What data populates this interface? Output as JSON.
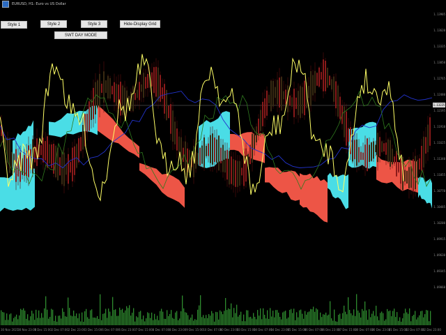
{
  "window": {
    "title": "EURUSD, H1: Euro vs US Dollar",
    "icon": "chart-window-icon"
  },
  "buttons": [
    {
      "id": "style1",
      "label": "Style 1"
    },
    {
      "id": "style2",
      "label": "Style 2"
    },
    {
      "id": "style3",
      "label": "Style 3"
    },
    {
      "id": "grid",
      "label": "Hide-Display Grid"
    },
    {
      "id": "daymode",
      "label": "SWT DAY MODE"
    }
  ],
  "price_axis": {
    "ticks": [
      "1.13905",
      "1.13620",
      "1.13335",
      "1.13050",
      "1.12765",
      "1.12480",
      "1.12195",
      "1.11910",
      "1.11625",
      "1.11340",
      "1.11055",
      "1.10770",
      "1.10485",
      "1.10200",
      "1.09915",
      "1.09630",
      "1.09345",
      "1.09060"
    ],
    "current_price": "1.13225"
  },
  "date_axis": [
    "30 Nov 2021",
    "30 Nov 23:00",
    "1 Dec 15:00",
    "2 Dec 07:00",
    "2 Dec 23:00",
    "3 Dec 15:00",
    "6 Dec 07:00",
    "6 Dec 23:00",
    "7 Dec 15:00",
    "8 Dec 07:00",
    "8 Dec 23:00",
    "9 Dec 15:00",
    "10 Dec 07:00",
    "10 Dec 23:00",
    "13 Dec 15:00",
    "14 Dec 07:00",
    "14 Dec 23:00",
    "15 Dec 15:00",
    "16 Dec 07:00",
    "16 Dec 23:00",
    "17 Dec 15:00",
    "20 Dec 07:00",
    "20 Dec 23:00",
    "21 Dec 15:00",
    "22 Dec 07:00",
    "22 Dec 23:00"
  ],
  "colors": {
    "background": "#000000",
    "cloud_bull": "#4ee9f2",
    "cloud_bear": "#fa5a4a",
    "price_line": "#ffff66",
    "candles": "#8a1a1a",
    "volume": "#2e8b2e",
    "blue_line": "#2233cc"
  }
}
